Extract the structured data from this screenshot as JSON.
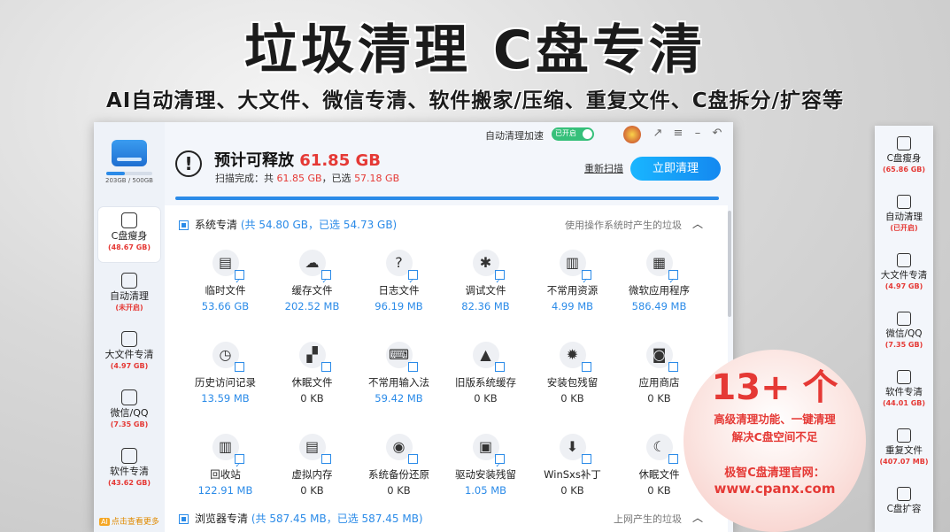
{
  "banner": {
    "title": "垃圾清理 C盘专清",
    "subtitle": "AI自动清理、大文件、微信专清、软件搬家/压缩、重复文件、C盘拆分/扩容等"
  },
  "app": {
    "disk": {
      "capacity": "203GB / 500GB",
      "used_fraction": 0.406
    },
    "nav": [
      {
        "label": "C盘瘦身",
        "sub": "(48.67 GB)",
        "icon": "disk-slim-icon"
      },
      {
        "label": "自动清理",
        "sub": "(未开启)",
        "icon": "broom-icon"
      },
      {
        "label": "大文件专清",
        "sub": "(4.97 GB)",
        "icon": "folder-icon"
      },
      {
        "label": "微信/QQ",
        "sub": "(7.35 GB)",
        "icon": "chat-icon"
      },
      {
        "label": "软件专清",
        "sub": "(43.62 GB)",
        "icon": "apps-icon"
      }
    ],
    "more_link": "点击查看更多",
    "more_badge": "AI",
    "titlebar": {
      "auto_clean_label": "自动清理加速",
      "toggle_text": "已开启"
    },
    "header": {
      "est_label": "预计可释放",
      "est_value": "61.85 GB",
      "scan_prefix": "扫描完成：共",
      "scan_total": "61.85 GB",
      "scan_mid": "，已选",
      "scan_selected": "57.18 GB",
      "rescan": "重新扫描",
      "clean_button": "立即清理",
      "progress": 1.0
    },
    "section1": {
      "title": "系统专清",
      "stat": "(共 54.80 GB，已选 54.73 GB)",
      "desc": "使用操作系统时产生的垃圾",
      "toggle": "︿"
    },
    "items": [
      {
        "label": "临时文件",
        "size": "53.66 GB",
        "icon": "temp-file-icon",
        "glyph": "▤",
        "checked": true
      },
      {
        "label": "缓存文件",
        "size": "202.52 MB",
        "icon": "cloud-cache-icon",
        "glyph": "☁",
        "checked": true
      },
      {
        "label": "日志文件",
        "size": "96.19 MB",
        "icon": "log-file-icon",
        "glyph": "?",
        "checked": true
      },
      {
        "label": "调试文件",
        "size": "82.36 MB",
        "icon": "bug-icon",
        "glyph": "✱",
        "checked": true
      },
      {
        "label": "不常用资源",
        "size": "4.99 MB",
        "icon": "resource-icon",
        "glyph": "▥",
        "checked": true
      },
      {
        "label": "微软应用程序",
        "size": "586.49 MB",
        "icon": "windows-icon",
        "glyph": "▦",
        "checked": true
      },
      {
        "label": "历史访问记录",
        "size": "13.59 MB",
        "icon": "history-icon",
        "glyph": "◷",
        "checked": false
      },
      {
        "label": "休眠文件",
        "size": "0 KB",
        "icon": "sleep-file-icon",
        "glyph": "▞",
        "checked": false
      },
      {
        "label": "不常用输入法",
        "size": "59.42 MB",
        "icon": "keyboard-icon",
        "glyph": "⌨",
        "checked": false
      },
      {
        "label": "旧版系统缓存",
        "size": "0 KB",
        "icon": "old-cache-icon",
        "glyph": "▲",
        "checked": false
      },
      {
        "label": "安装包残留",
        "size": "0 KB",
        "icon": "package-icon",
        "glyph": "✹",
        "checked": false
      },
      {
        "label": "应用商店",
        "size": "0 KB",
        "icon": "store-icon",
        "glyph": "◙",
        "checked": false
      },
      {
        "label": "回收站",
        "size": "122.91 MB",
        "icon": "recycle-bin-icon",
        "glyph": "▥",
        "checked": true
      },
      {
        "label": "虚拟内存",
        "size": "0 KB",
        "icon": "memory-icon",
        "glyph": "▤",
        "checked": false
      },
      {
        "label": "系统备份还原",
        "size": "0 KB",
        "icon": "backup-icon",
        "glyph": "◉",
        "checked": false
      },
      {
        "label": "驱动安装残留",
        "size": "1.05 MB",
        "icon": "driver-icon",
        "glyph": "▣",
        "checked": true
      },
      {
        "label": "WinSxs补丁",
        "size": "0 KB",
        "icon": "patch-icon",
        "glyph": "⬇",
        "checked": false
      },
      {
        "label": "休眠文件",
        "size": "0 KB",
        "icon": "moon-icon",
        "glyph": "☾",
        "checked": false
      }
    ],
    "section2": {
      "title": "浏览器专清",
      "stat": "(共 587.45 MB，已选 587.45 MB)",
      "desc": "上网产生的垃圾",
      "toggle": "︿"
    }
  },
  "promo": {
    "number": "13+ 个",
    "line1": "高级清理功能、一键清理",
    "line2": "解决C盘空间不足",
    "line3": "极智C盘清理官网：",
    "url": "www.cpanx.com"
  },
  "right_nav": [
    {
      "label": "C盘瘦身",
      "sub": "(65.86 GB)"
    },
    {
      "label": "自动清理",
      "sub": "(已开启)"
    },
    {
      "label": "大文件专清",
      "sub": "(4.97 GB)"
    },
    {
      "label": "微信/QQ",
      "sub": "(7.35 GB)"
    },
    {
      "label": "软件专清",
      "sub": "(44.01 GB)"
    },
    {
      "label": "重复文件",
      "sub": "(407.07 MB)"
    },
    {
      "label": "C盘扩容",
      "sub": ""
    }
  ],
  "colors": {
    "accent": "#2b8be8",
    "danger": "#e53935",
    "toggle_on": "#36c07a"
  }
}
